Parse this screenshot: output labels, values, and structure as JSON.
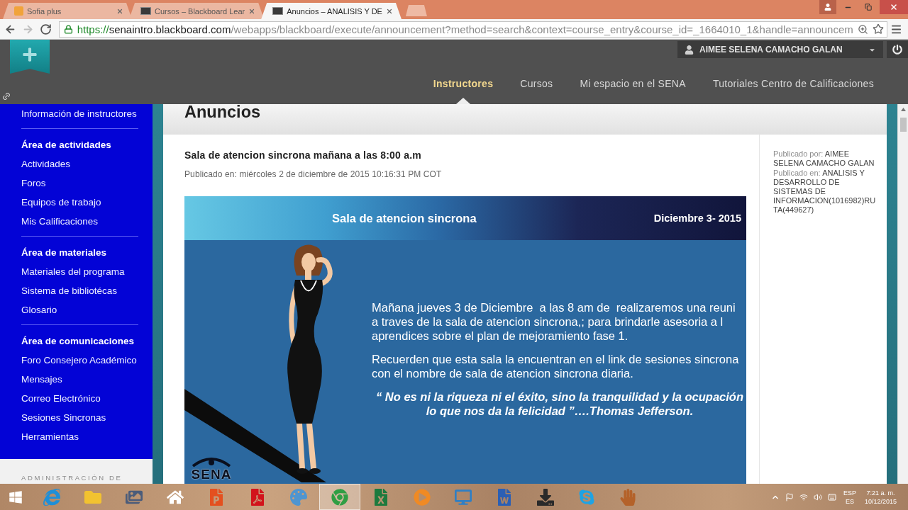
{
  "browser": {
    "tabs": [
      {
        "title": "Sofia plus",
        "kind": "s-logo",
        "selected": false
      },
      {
        "title": "Cursos – Blackboard Lear",
        "kind": "dark-tile",
        "selected": false
      },
      {
        "title": "Anuncios – ANALISIS Y DE",
        "kind": "dark-tile",
        "selected": true
      }
    ],
    "nav_buttons": [
      {
        "kind": "back",
        "disabled": false
      },
      {
        "kind": "forward",
        "disabled": true
      },
      {
        "kind": "reload",
        "disabled": false
      }
    ],
    "url": {
      "scheme": "https://",
      "host": "senaintro.blackboard.com",
      "path": "/webapps/blackboard/execute/announcement?method=search&context=course_entry&course_id=_1664010_1&handle=announcem"
    }
  },
  "header": {
    "user": "AIMEE SELENA CAMACHO GALAN",
    "nav": [
      {
        "label": "Instructores",
        "selected": true
      },
      {
        "label": "Cursos",
        "selected": false
      },
      {
        "label": "Mi espacio en el SENA",
        "selected": false
      },
      {
        "label": "Tutoriales Centro de Calificaciones",
        "selected": false
      }
    ]
  },
  "sidebar": {
    "sections": [
      {
        "items": [
          "Información de instructores"
        ]
      },
      {
        "heading": "Área de actividades",
        "items": [
          "Actividades",
          "Foros",
          "Equipos de trabajo",
          "Mis Calificaciones"
        ]
      },
      {
        "heading": "Área de materiales",
        "items": [
          "Materiales del programa",
          "Sistema de bibliotécas",
          "Glosario"
        ]
      },
      {
        "heading": "Área de comunicaciones",
        "items": [
          "Foro Consejero Académico",
          "Mensajes",
          "Correo Electrónico",
          "Sesiones Sincronas",
          "Herramientas"
        ]
      }
    ],
    "panel_title": "ADMINISTRACIÓN DE"
  },
  "page": {
    "title": "Anuncios"
  },
  "announcement": {
    "title": "Sala de atencion sincrona mañana a las 8:00 a.m",
    "posted": "Publicado en: miércoles 2 de diciembre de 2015 10:16:31 PM COT",
    "banner": {
      "heading": "Sala de atencion sincrona",
      "date": "Diciembre 3- 2015",
      "paragraphs": [
        [
          "Mañana jueves 3 de Diciembre  a las 8 am de  realizaremos una reuni",
          "a traves de la sala de atencion sincrona,; para brindarle asesoria a l",
          "aprendices sobre el plan de mejoramiento fase 1."
        ],
        [
          "Recuerden que esta sala la encuentran en el link de sesiones sincrona",
          "con el nombre de sala de atencion sincrona diaria."
        ]
      ],
      "quote": [
        "“ No es ni la riqueza ni el éxito, sino la tranquilidad y la ocupación",
        "lo que nos da la felicidad ”….Thomas Jefferson."
      ],
      "logo": "SENA"
    },
    "meta": [
      {
        "label": "Publicado por:",
        "value": "AIMEE SELENA CAMACHO GALAN"
      },
      {
        "label": "Publicado en:",
        "value": "ANALISIS Y DESARROLLO DE SISTEMAS DE INFORMACION(1016982)RUTA(449627)"
      }
    ]
  },
  "taskbar": {
    "apps": [
      {
        "kind": "start",
        "selected": false
      },
      {
        "kind": "letter-e",
        "selected": false
      },
      {
        "kind": "folder",
        "selected": false
      },
      {
        "kind": "photos",
        "selected": false
      },
      {
        "kind": "home",
        "selected": false
      },
      {
        "kind": "orange-doc",
        "selected": false
      },
      {
        "kind": "pdf",
        "selected": false
      },
      {
        "kind": "paint",
        "selected": false
      },
      {
        "kind": "browser",
        "selected": true
      },
      {
        "kind": "spreadsheet",
        "selected": false
      },
      {
        "kind": "media",
        "selected": false
      },
      {
        "kind": "monitor",
        "selected": false
      },
      {
        "kind": "document",
        "selected": false
      },
      {
        "kind": "download",
        "selected": false
      },
      {
        "kind": "chat",
        "selected": false
      },
      {
        "kind": "hand",
        "selected": false
      }
    ],
    "tray": {
      "language": "ESP",
      "layout": "ES",
      "time": "7:21 a. m.",
      "date": "10/12/2015"
    }
  }
}
